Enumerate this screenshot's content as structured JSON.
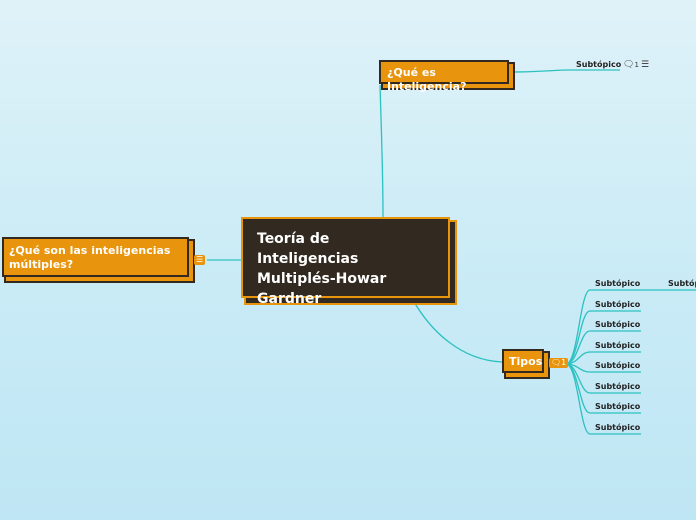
{
  "central": {
    "title": "Teoría de Inteligencias Multiplés-Howar Gardner"
  },
  "topics": {
    "que_es": {
      "label": "¿Qué es Inteligencia?",
      "subtopic": "Subtópico",
      "comment_count": "1"
    },
    "multiples": {
      "label": "¿Qué son las inteligencias múltiples?"
    },
    "tipos": {
      "label": "Tipos",
      "comment_count": "1",
      "subtopics": [
        "Subtópico",
        "Subtópico",
        "Subtópico",
        "Subtópico",
        "Subtópico",
        "Subtópico",
        "Subtópico",
        "Subtópico"
      ],
      "nested_subtopic": "Subtóp"
    }
  },
  "colors": {
    "accent": "#e8940c",
    "dark": "#322a20",
    "link": "#2cc1c0",
    "background": "#cdeef8"
  },
  "icons": [
    "comment-icon",
    "notes-icon"
  ]
}
